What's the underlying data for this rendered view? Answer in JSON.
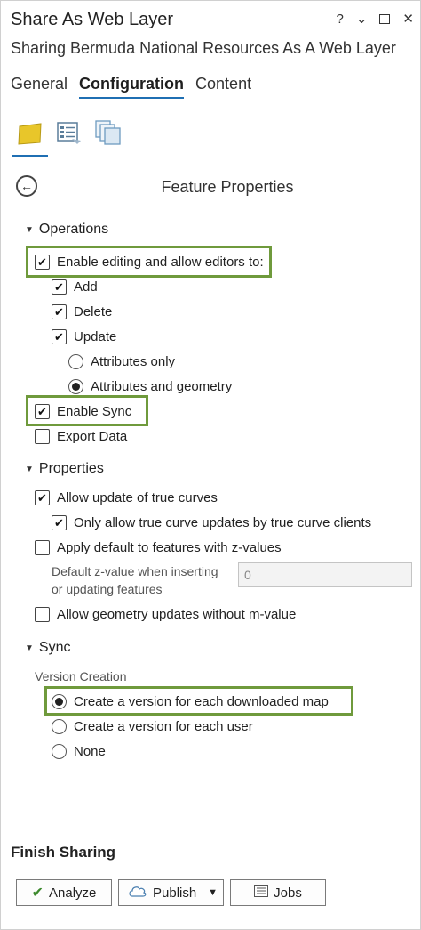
{
  "window": {
    "title": "Share As Web Layer",
    "controls": [
      "?",
      "⌄",
      "□",
      "✕"
    ]
  },
  "subtitle": "Sharing Bermuda National Resources  As A Web Layer",
  "tabs": [
    {
      "label": "General",
      "active": false
    },
    {
      "label": "Configuration",
      "active": true
    },
    {
      "label": "Content",
      "active": false
    }
  ],
  "panel_title": "Feature Properties",
  "operations": {
    "header": "Operations",
    "enable_editing": {
      "label": "Enable editing and allow editors to:",
      "checked": true
    },
    "add": {
      "label": "Add",
      "checked": true
    },
    "delete": {
      "label": "Delete",
      "checked": true
    },
    "update": {
      "label": "Update",
      "checked": true
    },
    "attributes_only": {
      "label": "Attributes only",
      "selected": false
    },
    "attributes_geometry": {
      "label": "Attributes and geometry",
      "selected": true
    },
    "enable_sync": {
      "label": "Enable Sync",
      "checked": true
    },
    "export_data": {
      "label": "Export Data",
      "checked": false
    }
  },
  "properties": {
    "header": "Properties",
    "true_curves": {
      "label": "Allow update of true curves",
      "checked": true
    },
    "true_curve_clients": {
      "label": "Only allow true curve updates by true curve clients",
      "checked": true
    },
    "z_default": {
      "label": "Apply default to features with z-values",
      "checked": false
    },
    "z_value_label_1": "Default z-value when inserting",
    "z_value_label_2": "or updating features",
    "z_value_placeholder": "0",
    "no_m_value": {
      "label": "Allow geometry updates without m-value",
      "checked": false
    }
  },
  "sync": {
    "header": "Sync",
    "version_creation_label": "Version Creation",
    "options": [
      {
        "label": "Create a version for each downloaded map",
        "selected": true
      },
      {
        "label": "Create a version for each user",
        "selected": false
      },
      {
        "label": "None",
        "selected": false
      }
    ]
  },
  "finish": {
    "title": "Finish Sharing",
    "analyze": "Analyze",
    "publish": "Publish",
    "jobs": "Jobs"
  },
  "colors": {
    "highlight": "#6f9a3c",
    "tab_underline": "#1f6fb3",
    "layer_icon": "#e8c62a"
  }
}
